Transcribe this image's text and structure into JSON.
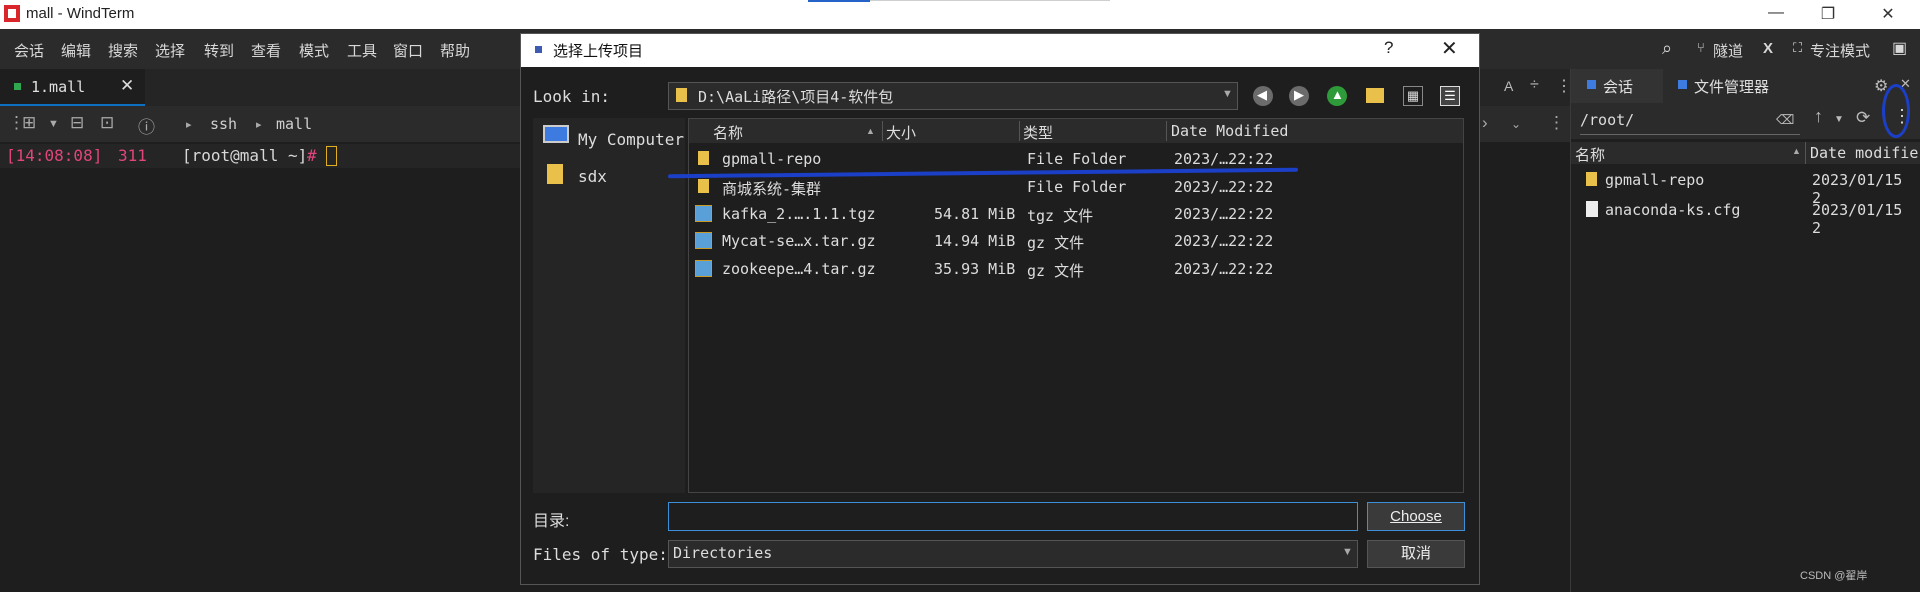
{
  "window": {
    "title": "mall - WindTerm",
    "min": "—",
    "restore": "❐",
    "close": "✕"
  },
  "menu": {
    "items": [
      "会话",
      "编辑",
      "搜索",
      "选择",
      "转到",
      "查看",
      "模式",
      "工具",
      "窗口",
      "帮助"
    ],
    "right": {
      "search": "⌕",
      "tunnel": "隧道",
      "x": "X",
      "focus": "专注模式"
    }
  },
  "tab": {
    "label": "1.mall",
    "close": "✕"
  },
  "toolbar": {
    "crumb_ssh": "ssh",
    "crumb_mall": "mall"
  },
  "terminal": {
    "time": "[14:08:08]",
    "num": "311",
    "user": "[root@mall ~]",
    "hash": "#"
  },
  "right_panel": {
    "tab_session": "会话",
    "tab_files": "文件管理器",
    "path": "/root/",
    "col_name": "名称",
    "col_date": "Date modifie",
    "rows": [
      {
        "name": "gpmall-repo",
        "date": "2023/01/15 2",
        "kind": "folder"
      },
      {
        "name": "anaconda-ks.cfg",
        "date": "2023/01/15 2",
        "kind": "file"
      }
    ]
  },
  "dialog": {
    "title": "选择上传项目",
    "help": "?",
    "close": "✕",
    "look_in_label": "Look in:",
    "look_in_path": "D:\\AaLi路径\\项目4-软件包",
    "places": [
      {
        "label": "My Computer"
      },
      {
        "label": "sdx"
      }
    ],
    "columns": {
      "name": "名称",
      "size": "大小",
      "type": "类型",
      "date": "Date Modified"
    },
    "files": [
      {
        "name": "gpmall-repo",
        "size": "",
        "type": "File Folder",
        "date": "2023/…22:22",
        "kind": "folder"
      },
      {
        "name": "商城系统-集群",
        "size": "",
        "type": "File Folder",
        "date": "2023/…22:22",
        "kind": "folder"
      },
      {
        "name": "kafka_2.….1.1.tgz",
        "size": "54.81 MiB",
        "type": "tgz 文件",
        "date": "2023/…22:22",
        "kind": "archive"
      },
      {
        "name": "Mycat-se…x.tar.gz",
        "size": "14.94 MiB",
        "type": "gz 文件",
        "date": "2023/…22:22",
        "kind": "archive"
      },
      {
        "name": "zookeepe…4.tar.gz",
        "size": "35.93 MiB",
        "type": "gz 文件",
        "date": "2023/…22:22",
        "kind": "archive"
      }
    ],
    "dir_label": "目录:",
    "dir_value": "",
    "choose": "Choose",
    "type_label": "Files of type:",
    "type_value": "Directories",
    "cancel": "取消"
  },
  "watermark": "CSDN @翟岸",
  "accent_colors": {
    "blue": "#1c3fc7",
    "focus": "#3d8fd8",
    "prompt": "#e0457b"
  }
}
